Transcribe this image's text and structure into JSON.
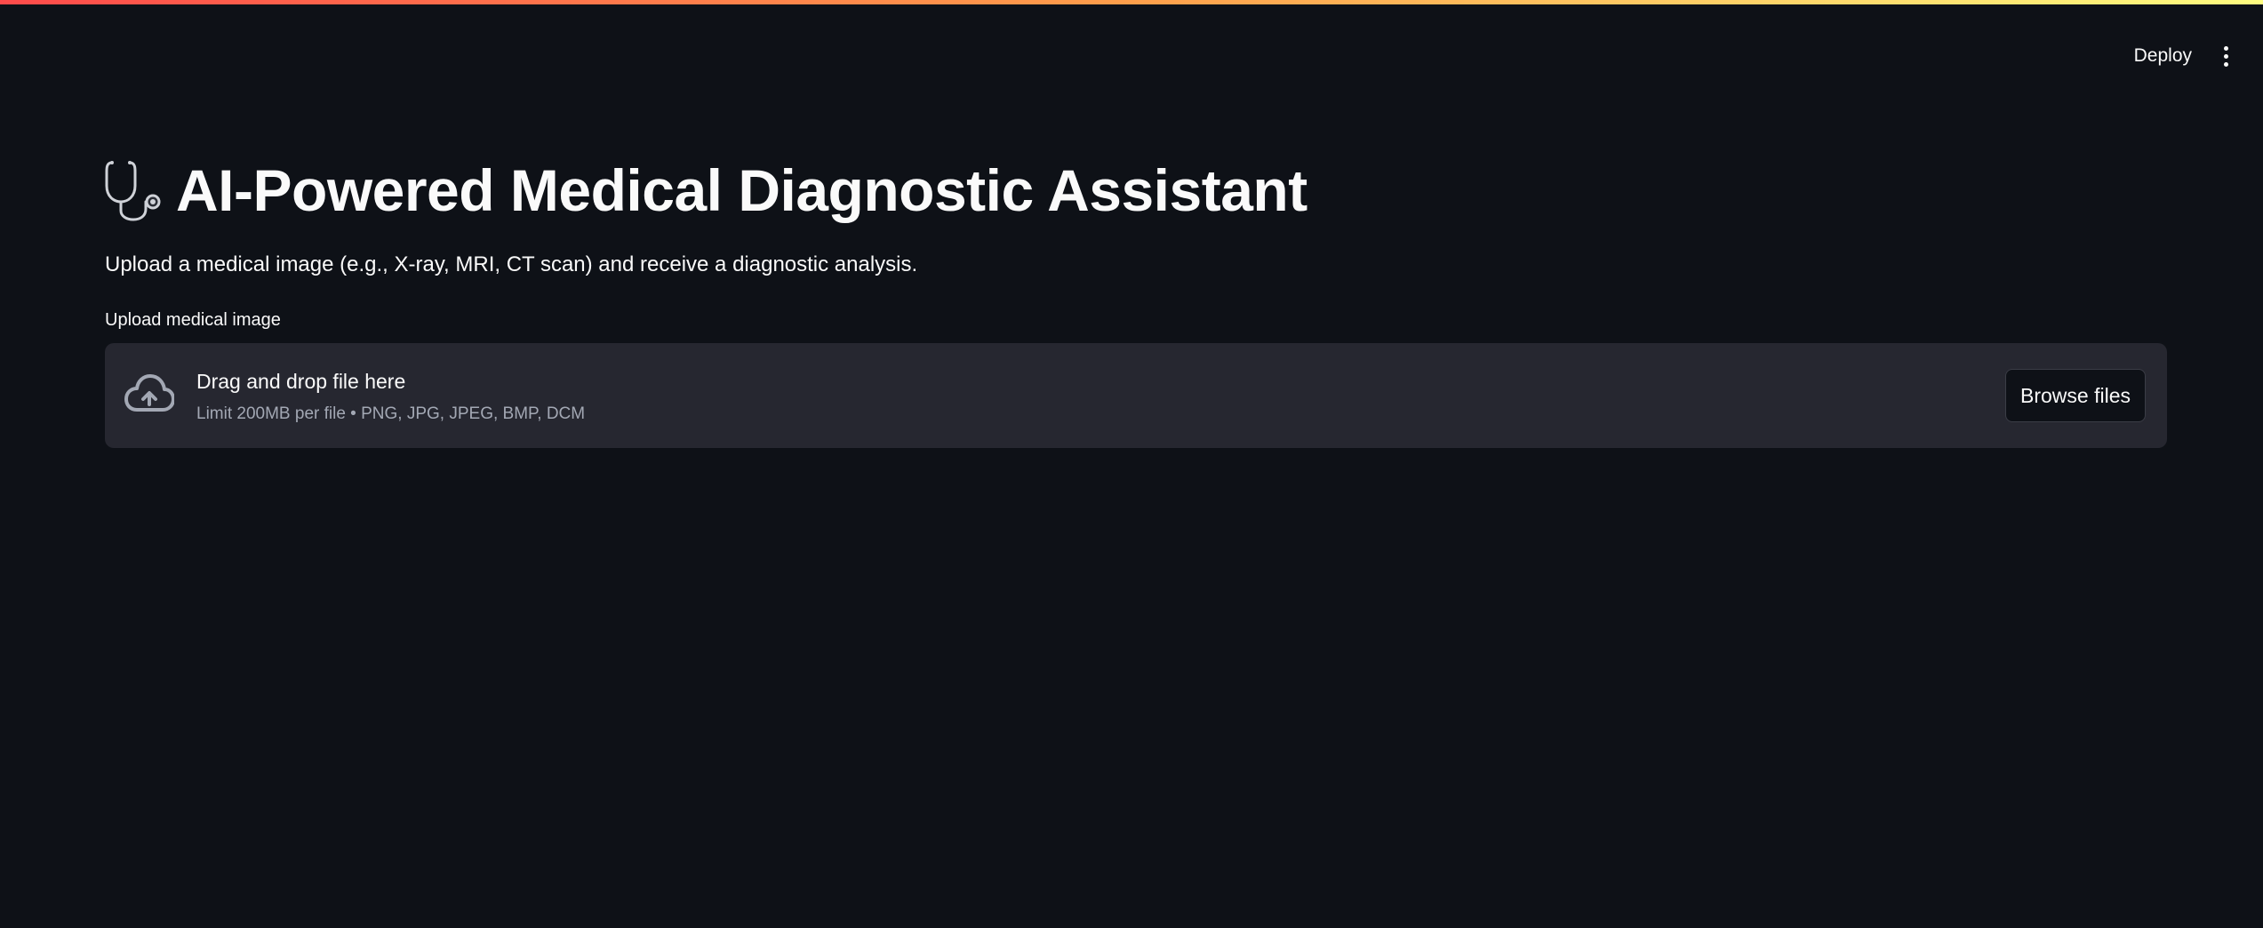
{
  "header": {
    "deploy_label": "Deploy",
    "menu_icon": "more-vertical-icon"
  },
  "main": {
    "title_icon": "stethoscope-icon",
    "title": "AI-Powered Medical Diagnostic Assistant",
    "subtitle": "Upload a medical image (e.g., X-ray, MRI, CT scan) and receive a diagnostic analysis."
  },
  "uploader": {
    "label": "Upload medical image",
    "icon": "cloud-upload-icon",
    "drop_text": "Drag and drop file here",
    "limit_text": "Limit 200MB per file • PNG, JPG, JPEG, BMP, DCM",
    "browse_label": "Browse files"
  },
  "colors": {
    "background": "#0e1117",
    "dropzone": "#262730",
    "text": "#fafafa",
    "muted_text": "#a3a8b4",
    "accent_gradient_start": "#ff4b4b",
    "accent_gradient_end": "#fffd80"
  }
}
